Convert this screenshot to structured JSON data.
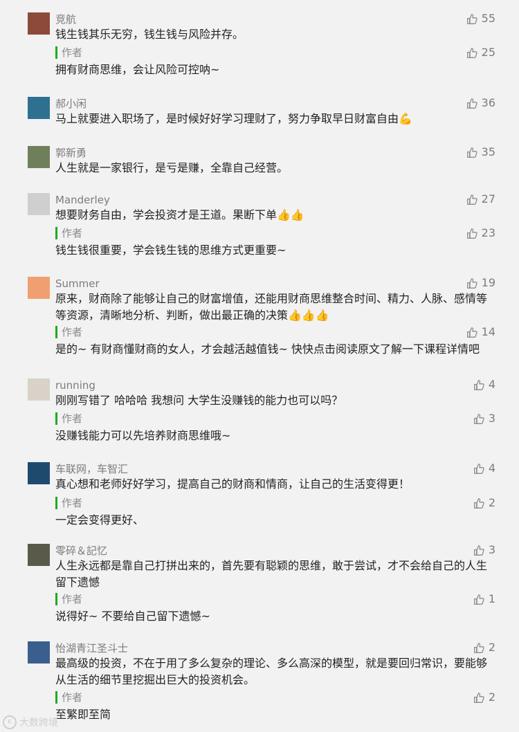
{
  "reply_label": "作者",
  "watermark": {
    "logo": "K",
    "text": "大数跨境"
  },
  "comments": [
    {
      "name": "竞航",
      "text": "钱生钱其乐无穷，钱生钱与风险并存。",
      "likes": "55",
      "avatar_color": "#8d4a3a",
      "reply": {
        "text": "拥有财商思维，会让风险可控呐~",
        "likes": "25"
      }
    },
    {
      "name": "郝小闲",
      "text": "马上就要进入职场了，是时候好好学习理财了，努力争取早日财富自由💪",
      "likes": "36",
      "avatar_color": "#2f6f8f"
    },
    {
      "name": "郭新勇",
      "text": "人生就是一家银行，是亏是赚，全靠自己经营。",
      "likes": "35",
      "avatar_color": "#6f7f5a"
    },
    {
      "name": "Manderley",
      "text": "想要财务自由，学会投资才是王道。果断下单👍👍",
      "likes": "27",
      "avatar_color": "#cfcfcf",
      "reply": {
        "text": "钱生钱很重要，学会钱生钱的思维方式更重要~",
        "likes": "23"
      }
    },
    {
      "name": "Summer",
      "text": "原来，财商除了能够让自己的财富增值，还能用财商思维整合时间、精力、人脉、感情等等资源，清晰地分析、判断，做出最正确的决策👍👍👍",
      "likes": "19",
      "avatar_color": "#f0a070",
      "reply": {
        "text": "是的~ 有财商懂财商的女人，才会越活越值钱~ 快快点击阅读原文了解一下课程详情吧",
        "likes": "14"
      }
    },
    {
      "name": "running",
      "text": "刚刚写错了 哈哈哈 我想问 大学生没赚钱的能力也可以吗？",
      "likes": "4",
      "avatar_color": "#d8d2c8",
      "reply": {
        "text": "没赚钱能力可以先培养财商思维哦~",
        "likes": "3"
      }
    },
    {
      "name": "车联网，车智汇",
      "text": "真心想和老师好好学习，提高自己的财商和情商，让自己的生活变得更！",
      "likes": "4",
      "avatar_color": "#1e4a6e",
      "reply": {
        "text": "一定会变得更好、",
        "likes": "2"
      }
    },
    {
      "name": "零碎＆記忆",
      "text": "人生永远都是靠自己打拼出来的，首先要有聪颖的思维，敢于尝试，才不会给自己的人生留下遗憾",
      "likes": "3",
      "avatar_color": "#5a5a4a",
      "reply": {
        "text": "说得好~ 不要给自己留下遗憾~",
        "likes": "1"
      }
    },
    {
      "name": "怡湖青江圣斗士",
      "text": "最高级的投资，不在于用了多么复杂的理论、多么高深的模型，就是要回归常识，要能够从生活的细节里挖掘出巨大的投资机会。",
      "likes": "2",
      "avatar_color": "#3a5f8f",
      "reply": {
        "text": "至繁即至简",
        "likes": "2"
      }
    }
  ]
}
